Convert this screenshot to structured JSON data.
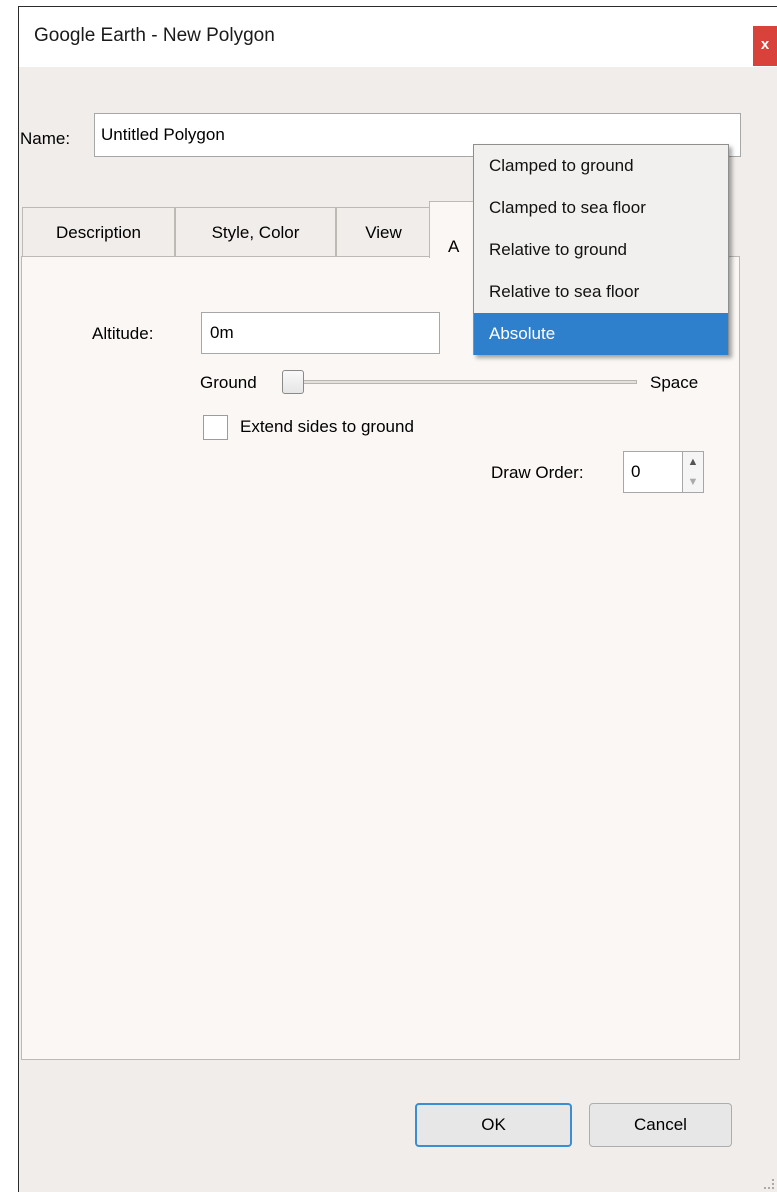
{
  "window": {
    "title": "Google Earth - New Polygon",
    "close_label": "x"
  },
  "name_field": {
    "label": "Name:",
    "value": "Untitled Polygon"
  },
  "tabs": [
    {
      "label": "Description"
    },
    {
      "label": "Style, Color"
    },
    {
      "label": "View"
    },
    {
      "label": "A"
    }
  ],
  "altitude": {
    "label": "Altitude:",
    "value": "0m",
    "mode_options": [
      "Clamped to ground",
      "Clamped to sea floor",
      "Relative to ground",
      "Relative to sea floor",
      "Absolute"
    ],
    "selected_mode": "Absolute"
  },
  "slider": {
    "min_label": "Ground",
    "max_label": "Space",
    "position": 0
  },
  "extend_sides": {
    "label": "Extend sides to ground",
    "checked": false
  },
  "draw_order": {
    "label": "Draw Order:",
    "value": "0"
  },
  "buttons": {
    "ok": "OK",
    "cancel": "Cancel"
  },
  "colors": {
    "accent": "#2e7fcc",
    "close": "#d9413b",
    "dialog_bg": "#f0edea"
  }
}
